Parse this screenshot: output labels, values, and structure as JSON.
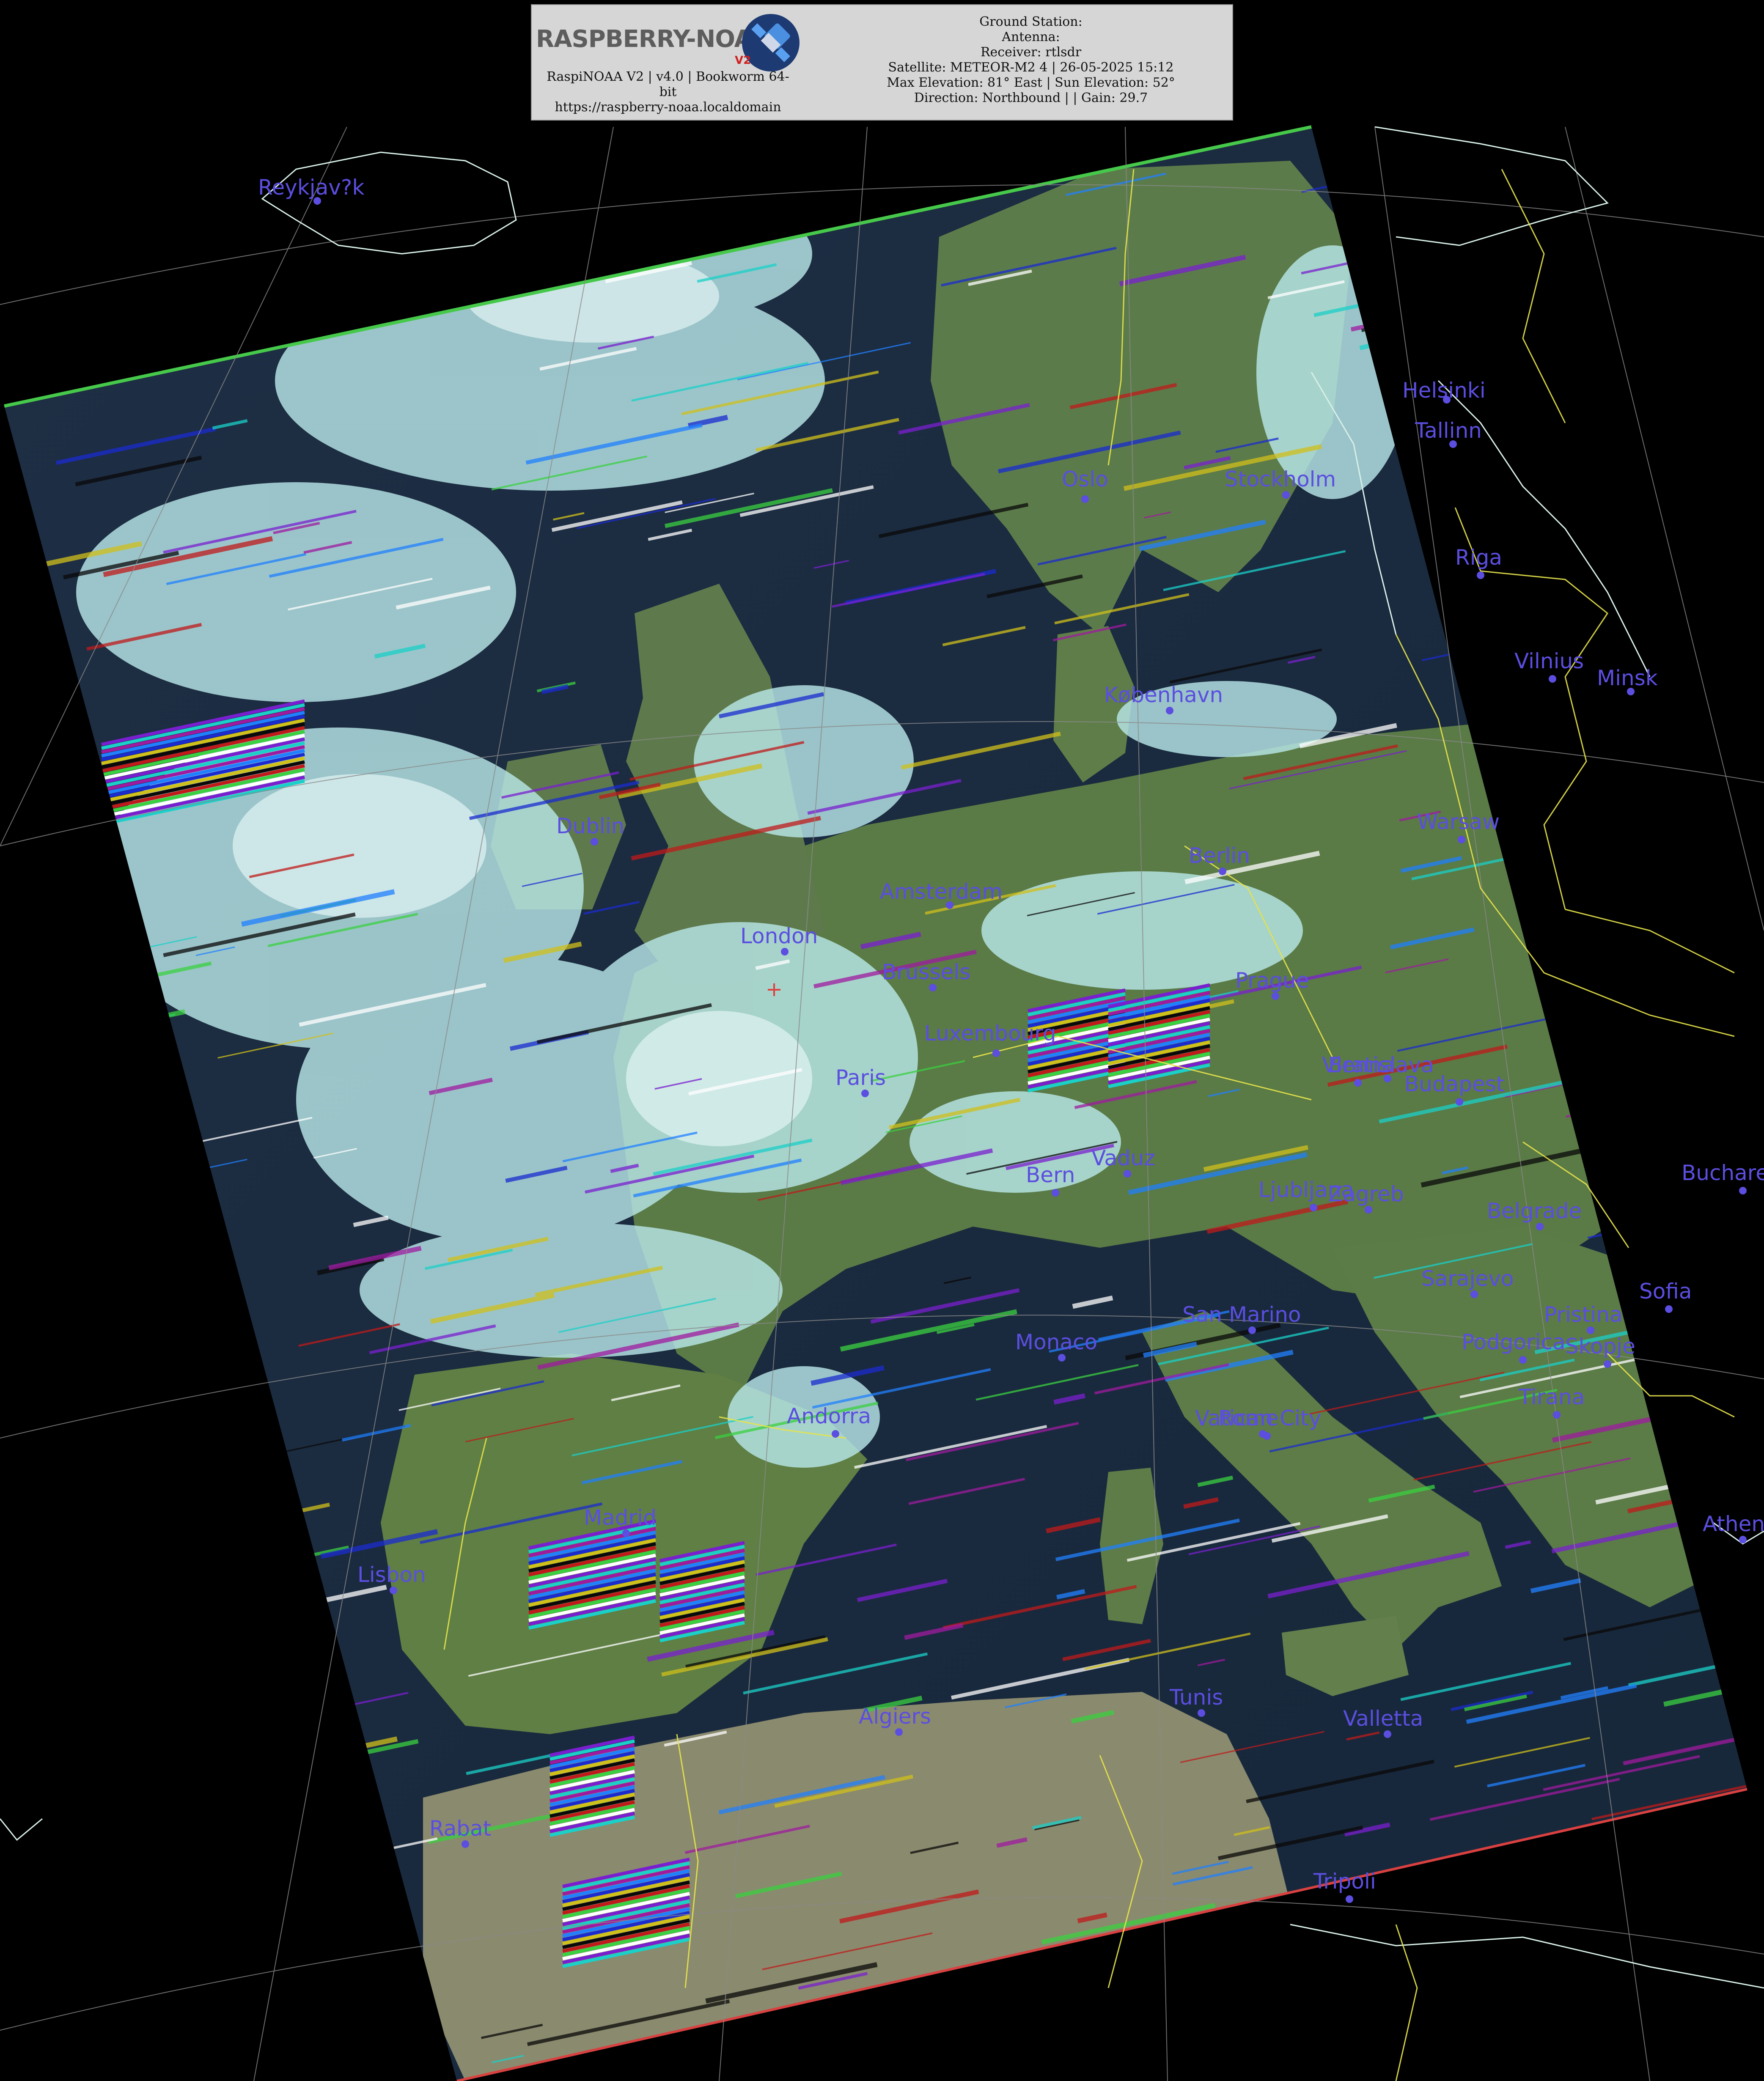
{
  "header": {
    "logo_text": "RASPBERRY-NOAA",
    "logo_version": "V2",
    "app_line_1": "RaspiNOAA V2 | v4.0 | Bookworm 64-",
    "app_line_2": "bit",
    "app_line_3": "https://raspberry-noaa.localdomain",
    "station_lines": [
      "Ground Station:",
      "Antenna:",
      "Receiver: rtlsdr",
      "Satellite: METEOR-M2 4 | 26-05-2025 15:12",
      "Max Elevation: 81° East | Sun Elevation: 52°",
      "Direction: Northbound | | Gain: 29.7"
    ]
  },
  "colors": {
    "city_label": "#5b4ee0",
    "coastline": "#d8f0e8",
    "borders": "#e6e34a",
    "graticule": "#8a8a8a",
    "cloud": "#bfe9ea",
    "land": "#5d7a48",
    "sea": "#1a2a3c"
  },
  "cities": [
    {
      "name": "Reykjav?k",
      "id": "reykjavik"
    },
    {
      "name": "Helsinki",
      "id": "helsinki"
    },
    {
      "name": "Tallinn",
      "id": "tallinn"
    },
    {
      "name": "Oslo",
      "id": "oslo"
    },
    {
      "name": "Stockholm",
      "id": "stockholm"
    },
    {
      "name": "Riga",
      "id": "riga"
    },
    {
      "name": "Vilnius",
      "id": "vilnius"
    },
    {
      "name": "Minsk",
      "id": "minsk"
    },
    {
      "name": "København",
      "id": "kobenhavn"
    },
    {
      "name": "Dublin",
      "id": "dublin"
    },
    {
      "name": "Warsaw",
      "id": "warsaw"
    },
    {
      "name": "Berlin",
      "id": "berlin"
    },
    {
      "name": "Amsterdam",
      "id": "amsterdam"
    },
    {
      "name": "London",
      "id": "london"
    },
    {
      "name": "Brussels",
      "id": "brussels"
    },
    {
      "name": "Prague",
      "id": "prague"
    },
    {
      "name": "Luxembourg",
      "id": "luxembourg"
    },
    {
      "name": "Vienna",
      "id": "vienna"
    },
    {
      "name": "Bratislava",
      "id": "bratislava"
    },
    {
      "name": "Budapest",
      "id": "budapest"
    },
    {
      "name": "Paris",
      "id": "paris"
    },
    {
      "name": "Bern",
      "id": "bern"
    },
    {
      "name": "Vaduz",
      "id": "vaduz"
    },
    {
      "name": "Ljubljana",
      "id": "ljubljana"
    },
    {
      "name": "Zagreb",
      "id": "zagreb"
    },
    {
      "name": "Belgrade",
      "id": "belgrade"
    },
    {
      "name": "Bucharest",
      "id": "bucharest"
    },
    {
      "name": "Sarajevo",
      "id": "sarajevo"
    },
    {
      "name": "Sofia",
      "id": "sofia"
    },
    {
      "name": "San Marino",
      "id": "sanmarino"
    },
    {
      "name": "Pristina",
      "id": "pristina"
    },
    {
      "name": "Podgorica",
      "id": "podgorica"
    },
    {
      "name": "Skopje",
      "id": "skopje"
    },
    {
      "name": "Monaco",
      "id": "monaco"
    },
    {
      "name": "Tirana",
      "id": "tirana"
    },
    {
      "name": "Andorra",
      "id": "andorra"
    },
    {
      "name": "Vatican City",
      "id": "vatican"
    },
    {
      "name": "Rome",
      "id": "rome"
    },
    {
      "name": "Madrid",
      "id": "madrid"
    },
    {
      "name": "Lisbon",
      "id": "lisbon"
    },
    {
      "name": "Athens",
      "id": "athens"
    },
    {
      "name": "Tunis",
      "id": "tunis"
    },
    {
      "name": "Algiers",
      "id": "algiers"
    },
    {
      "name": "Valletta",
      "id": "valletta"
    },
    {
      "name": "Rabat",
      "id": "rabat"
    },
    {
      "name": "Tripoli",
      "id": "tripoli"
    }
  ]
}
